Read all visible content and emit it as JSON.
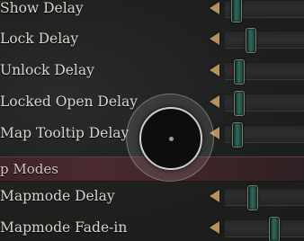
{
  "settings": {
    "rows": [
      {
        "label": "Show Delay",
        "value": 0.13
      },
      {
        "label": "Lock Delay",
        "value": 0.31
      },
      {
        "label": "Unlock Delay",
        "value": 0.17
      },
      {
        "label": "Locked Open Delay",
        "value": 0.17
      },
      {
        "label": "Map Tooltip Delay",
        "value": 0.14
      }
    ],
    "section_header": "p Modes",
    "rows2": [
      {
        "label": "Mapmode Delay",
        "value": 0.33
      },
      {
        "label": "Mapmode Fade-in",
        "value": 0.6
      }
    ]
  },
  "colors": {
    "arrow": "#b5925d",
    "handle": "#2f6a5d",
    "section_header_bg": "#4a2a30"
  },
  "icons": {
    "decrease": "left-triangle-arrow",
    "cursor": "circular-gamepad-cursor"
  }
}
